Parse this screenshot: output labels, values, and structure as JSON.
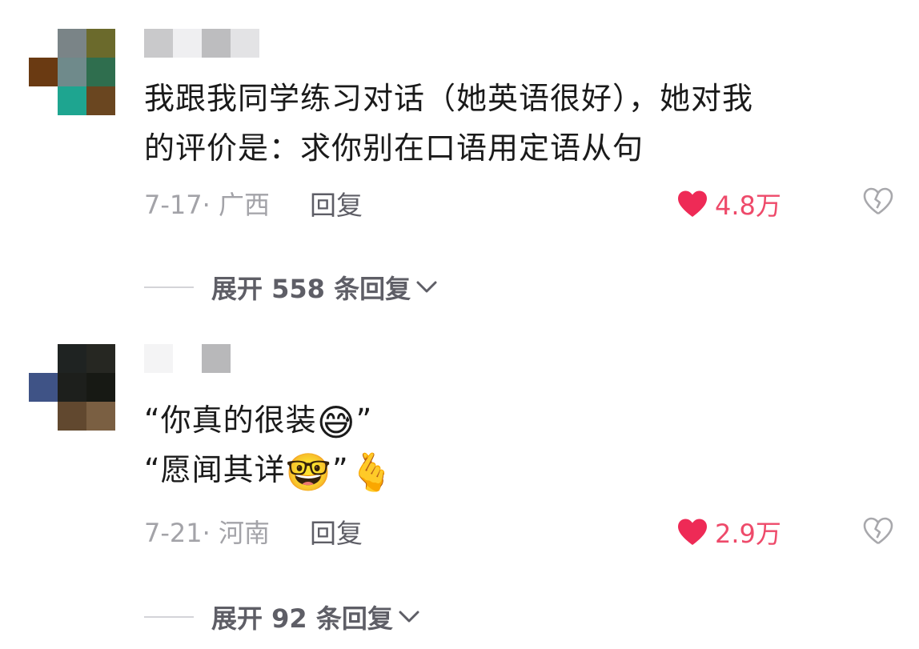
{
  "comments": [
    {
      "avatar_colors": [
        "#ffffff",
        "#7a8487",
        "#6b6a2c",
        "#6a3a12",
        "#6f8a8b",
        "#2f6e4e",
        "#ffffff",
        "#1ea590",
        "#6a4620"
      ],
      "username_colors": [
        "#c9c9cb",
        "#efeff1",
        "#bdbdbf",
        "#e3e3e5"
      ],
      "text_lines": [
        "我跟我同学练习对话（她英语很好），她对我",
        "的评价是：求你别在口语用定语从句"
      ],
      "date_location": "7-17· 广西",
      "reply_label": "回复",
      "like_count": "4.8万",
      "expand_label": "展开 558 条回复"
    },
    {
      "avatar_colors": [
        "#ffffff",
        "#1f2322",
        "#262722",
        "#3f5386",
        "#1d1f1c",
        "#171914",
        "#ffffff",
        "#61482f",
        "#7a5f42"
      ],
      "username_colors": [
        "#f4f4f5",
        "#ffffff",
        "#b8b8ba"
      ],
      "line1_text": "“你真的很装",
      "line1_emoji": "😅",
      "line1_close": "”",
      "line2_text": "“愿闻其详",
      "line2_emoji": "🤓",
      "line2_close": "”",
      "line2_emoji2": "🫰",
      "date_location": "7-21· 河南",
      "reply_label": "回复",
      "like_count": "2.9万",
      "expand_label": "展开 92 条回复"
    }
  ],
  "colors": {
    "like": "#ee4a6a",
    "meta": "#a3a3a8",
    "text": "#1a1a1a"
  },
  "icons": [
    "heart-icon",
    "broken-heart-icon",
    "chevron-down-icon"
  ]
}
